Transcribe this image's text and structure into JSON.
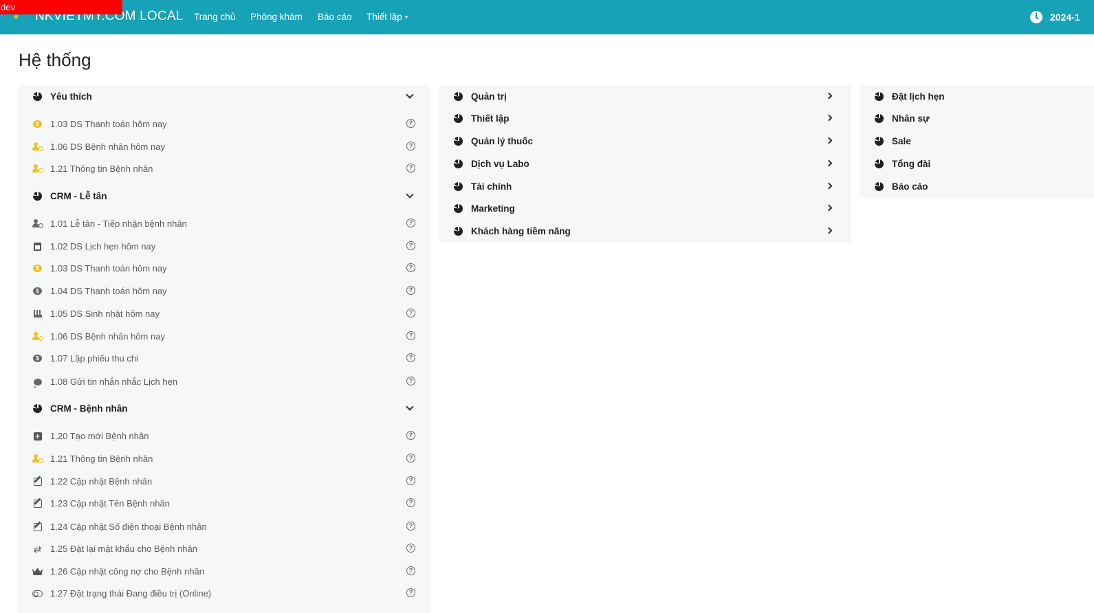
{
  "dev_badge": "dev",
  "brand": "NKVIETMY.COM LOCAL",
  "nav": {
    "home": "Trang chủ",
    "clinic": "Phòng khám",
    "report": "Báo cáo",
    "settings": "Thiết lập"
  },
  "datetime": "2024-1",
  "page_title": "Hệ thống",
  "col1": {
    "favorites": {
      "title": "Yêu thích",
      "items": [
        {
          "label": "1.03 DS Thanh toán hôm nay",
          "icon": "coin-icon"
        },
        {
          "label": "1.06 DS Bệnh nhân hôm nay",
          "icon": "user-tag-icon"
        },
        {
          "label": "1.21 Thông tin Bệnh nhân",
          "icon": "user-tag-icon"
        }
      ]
    },
    "crm_reception": {
      "title": "CRM - Lễ tân",
      "items": [
        {
          "label": "1.01 Lễ tân - Tiếp nhận bệnh nhân",
          "icon": "user-tag-icon"
        },
        {
          "label": "1.02 DS Lịch hẹn hôm nay",
          "icon": "calendar-check-icon"
        },
        {
          "label": "1.03 DS Thanh toán hôm nay",
          "icon": "coin-icon"
        },
        {
          "label": "1.04 DS Thanh toán hôm nay",
          "icon": "coin-icon"
        },
        {
          "label": "1.05 DS Sinh nhật hôm nay",
          "icon": "birthday-cake-icon"
        },
        {
          "label": "1.06 DS Bệnh nhân hôm nay",
          "icon": "user-tag-icon"
        },
        {
          "label": "1.07 Lập phiếu thu chi",
          "icon": "coin-icon"
        },
        {
          "label": "1.08 Gửi tin nhắn nhắc Lịch hẹn",
          "icon": "comment-icon"
        }
      ]
    },
    "crm_patient": {
      "title": "CRM - Bệnh nhân",
      "items": [
        {
          "label": "1.20 Tạo mới Bệnh nhân",
          "icon": "plus-square-icon"
        },
        {
          "label": "1.21 Thông tin Bệnh nhân",
          "icon": "user-tag-icon"
        },
        {
          "label": "1.22 Cập nhật Bệnh nhân",
          "icon": "edit-icon"
        },
        {
          "label": "1.23 Cập nhật Tên Bệnh nhân",
          "icon": "edit-icon"
        },
        {
          "label": "1.24 Cập nhật Số điện thoại Bệnh nhân",
          "icon": "edit-icon"
        },
        {
          "label": "1.25 Đặt lại mật khẩu cho Bệnh nhân",
          "icon": "retweet-icon"
        },
        {
          "label": "1.26 Cập nhật công nợ cho Bệnh nhân",
          "icon": "crown-icon"
        },
        {
          "label": "1.27 Đặt trạng thái Đang điều trị (Online)",
          "icon": "toggle-icon"
        }
      ]
    }
  },
  "col2": [
    "Quản trị",
    "Thiết lập",
    "Quản lý thuốc",
    "Dịch vụ Labo",
    "Tài chính",
    "Marketing",
    "Khách hàng tiềm năng"
  ],
  "col3": [
    "Đặt lịch hẹn",
    "Nhân sự",
    "Sale",
    "Tổng đài",
    "Báo cáo"
  ],
  "help_glyph": "?",
  "colors": {
    "topbar": "#17a2b8",
    "dev_badge": "#ff0000",
    "panel_bg": "#f6f7f9",
    "accent_yellow": "#f2c01e"
  }
}
